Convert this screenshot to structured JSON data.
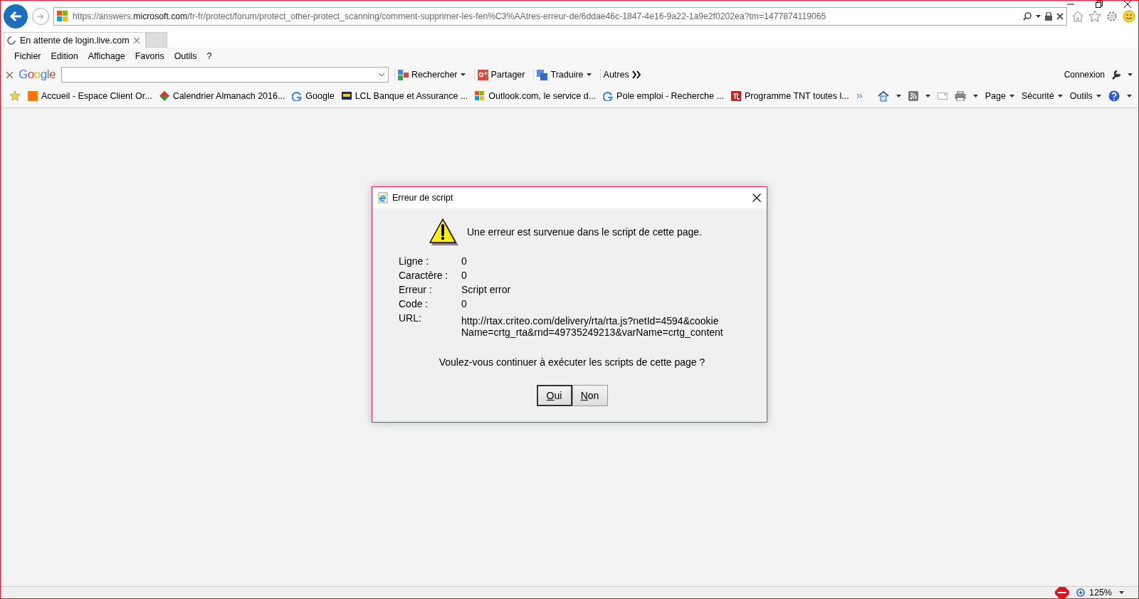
{
  "address_bar": {
    "url": "https://answers.**microsoft.com**/fr-fr/protect/forum/protect_other-protect_scanning/comment-supprimer-les-fen%C3%AAtres-erreur-de/6ddae46c-1847-4e16-9a22-1a9e2f0202ea?tm=1477874119065"
  },
  "tabs": [
    {
      "label": "En attente de login.live.com",
      "selected": true,
      "loading": true
    }
  ],
  "menu_bar": [
    "Fichier",
    "Edition",
    "Affichage",
    "Favoris",
    "Outils",
    "?"
  ],
  "google_toolbar": {
    "logo": "Google",
    "buttons": [
      {
        "label": "Rechercher",
        "kind": "search"
      },
      {
        "label": "Partager",
        "kind": "share"
      },
      {
        "label": "Traduire",
        "kind": "translate"
      },
      {
        "label": "Autres",
        "kind": "more"
      }
    ],
    "signin": "Connexion"
  },
  "favorites": [
    {
      "label": "Accueil - Espace Client Or...",
      "kind": "orange"
    },
    {
      "label": "Calendrier Almanach 2016...",
      "kind": "diamond"
    },
    {
      "label": "Google",
      "kind": "google"
    },
    {
      "label": "LCL Banque et Assurance ...",
      "kind": "lcl"
    },
    {
      "label": "Outlook.com, le service d...",
      "kind": "windows"
    },
    {
      "label": "Pole emploi - Recherche ...",
      "kind": "google"
    },
    {
      "label": "Programme TNT  toutes l...",
      "kind": "tl"
    }
  ],
  "command_bar": [
    "Page",
    "Sécurité",
    "Outils"
  ],
  "dialog": {
    "title": "Erreur de script",
    "message": "Une erreur est survenue dans le script de cette page.",
    "fields": [
      {
        "label": "Ligne :",
        "value": "0"
      },
      {
        "label": "Caractère :",
        "value": "0"
      },
      {
        "label": "Erreur :",
        "value": "Script error"
      },
      {
        "label": "Code :",
        "value": "0"
      },
      {
        "label": "URL:",
        "value": "http://rtax.criteo.com/delivery/rta/rta.js?netId=4594&cookieName=crtg_rta&rnd=49735249213&varName=crtg_content"
      }
    ],
    "question": "Voulez-vous continuer à exécuter les scripts de cette page ?",
    "buttons": [
      {
        "label": "Oui",
        "default": true
      },
      {
        "label": "Non",
        "default": false
      }
    ]
  },
  "status_bar": {
    "zoom": "125%"
  }
}
